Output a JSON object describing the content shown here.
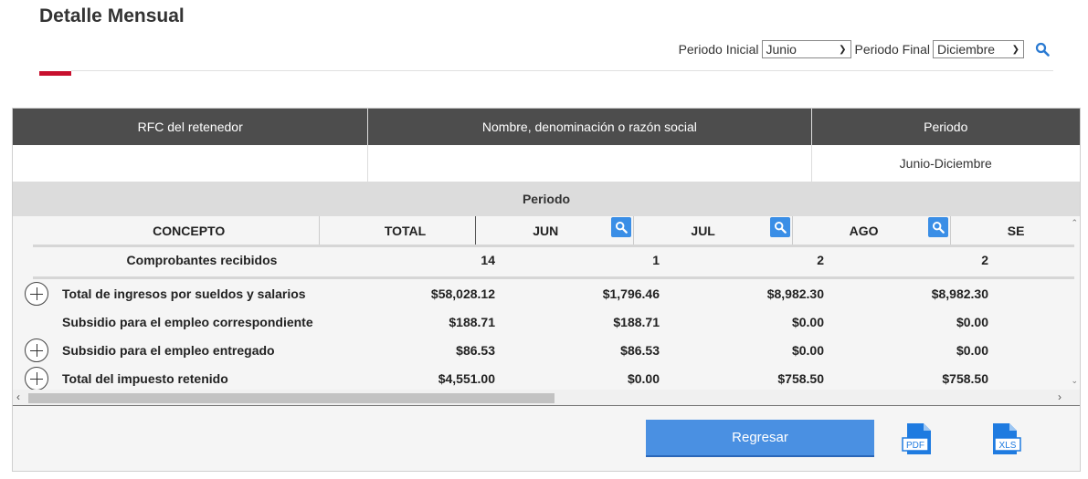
{
  "page": {
    "title": "Detalle Mensual"
  },
  "filters": {
    "initial_label": "Periodo Inicial",
    "initial_value": "Junio",
    "final_label": "Periodo Final",
    "final_value": "Diciembre"
  },
  "header_table": {
    "columns": [
      "RFC del retenedor",
      "Nombre, denominación o razón social",
      "Periodo"
    ],
    "values": [
      "",
      "",
      "Junio-Diciembre"
    ]
  },
  "grid": {
    "band_label": "Periodo",
    "columns": [
      "CONCEPTO",
      "TOTAL",
      "JUN",
      "JUL",
      "AGO",
      "SE"
    ],
    "count_row": {
      "label": "Comprobantes recibidos",
      "values": [
        "14",
        "1",
        "2",
        "2"
      ]
    },
    "rows": [
      {
        "label": "Total de ingresos por sueldos y salarios",
        "expandable": true,
        "values": [
          "$58,028.12",
          "$1,796.46",
          "$8,982.30",
          "$8,982.30"
        ]
      },
      {
        "label": "Subsidio para el empleo correspondiente",
        "expandable": false,
        "values": [
          "$188.71",
          "$188.71",
          "$0.00",
          "$0.00"
        ]
      },
      {
        "label": "Subsidio para el empleo entregado",
        "expandable": true,
        "values": [
          "$86.53",
          "$86.53",
          "$0.00",
          "$0.00"
        ]
      },
      {
        "label": "Total del impuesto retenido",
        "expandable": true,
        "values": [
          "$4,551.00",
          "$0.00",
          "$758.50",
          "$758.50"
        ]
      }
    ]
  },
  "footer": {
    "back_label": "Regresar",
    "pdf_label": "PDF",
    "xls_label": "XLS"
  },
  "colors": {
    "accent": "#c8102e",
    "header_bg": "#4d4d4d",
    "button": "#4a90e2"
  }
}
